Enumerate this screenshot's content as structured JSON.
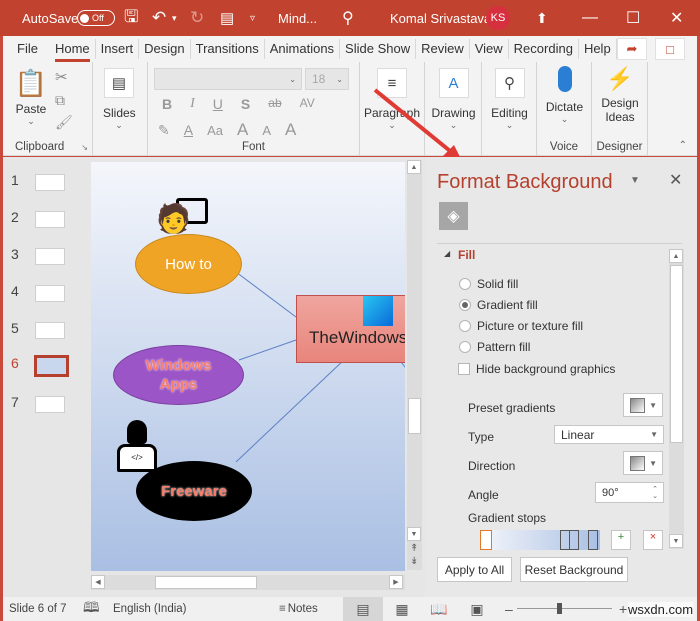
{
  "titlebar": {
    "autosave_label": "AutoSave",
    "autosave_state": "Off",
    "doc_title": "Mind...",
    "user_name": "Komal Srivastava",
    "user_initials": "KS"
  },
  "tabs": [
    "File",
    "Home",
    "Insert",
    "Design",
    "Transitions",
    "Animations",
    "Slide Show",
    "Review",
    "View",
    "Recording",
    "Help"
  ],
  "active_tab": "Home",
  "ribbon": {
    "clipboard": {
      "paste": "Paste",
      "label": "Clipboard"
    },
    "slides": {
      "label": "Slides"
    },
    "font": {
      "font_name": "",
      "font_size": "18",
      "label": "Font",
      "bold": "B",
      "italic": "I",
      "underline": "U",
      "shadow": "S",
      "strike": "ab",
      "spacing": "AV",
      "case": "Aa",
      "grow": "A",
      "shrink": "A",
      "clear": "A"
    },
    "paragraph": {
      "label": "Paragraph"
    },
    "drawing": {
      "label": "Drawing"
    },
    "editing": {
      "label": "Editing"
    },
    "voice": {
      "dictate": "Dictate",
      "label": "Voice"
    },
    "designer": {
      "design_ideas_1": "Design",
      "design_ideas_2": "Ideas",
      "label": "Designer"
    }
  },
  "slides_panel": {
    "slides": [
      "1",
      "2",
      "3",
      "4",
      "5",
      "6",
      "7"
    ],
    "selected": "6"
  },
  "slide": {
    "nodes": {
      "how_to": "How to",
      "windows_apps_1": "Windows",
      "windows_apps_2": "Apps",
      "freeware": "Freeware",
      "center": "TheWindowsClub"
    }
  },
  "format_background": {
    "title": "Format Background",
    "section": "Fill",
    "options": [
      {
        "label": "Solid fill",
        "checked": false
      },
      {
        "label": "Gradient fill",
        "checked": true
      },
      {
        "label": "Picture or texture fill",
        "checked": false
      },
      {
        "label": "Pattern fill",
        "checked": false
      }
    ],
    "hide_background_graphics": {
      "label": "Hide background graphics",
      "checked": false
    },
    "preset_gradients_label": "Preset gradients",
    "type_label": "Type",
    "type_value": "Linear",
    "direction_label": "Direction",
    "angle_label": "Angle",
    "angle_value": "90°",
    "gradient_stops_label": "Gradient stops",
    "apply_to_all": "Apply to All",
    "reset_background": "Reset Background"
  },
  "statusbar": {
    "slide_info": "Slide 6 of 7",
    "language": "English (India)",
    "notes": "Notes",
    "watermark": "wsxdn.com"
  },
  "colors": {
    "accent": "#c1432f",
    "how_to_fill": "#f0a425",
    "windows_apps_fill": "#9b55c6",
    "freeware_fill": "#000000",
    "center_fill": "#ec8f86"
  }
}
